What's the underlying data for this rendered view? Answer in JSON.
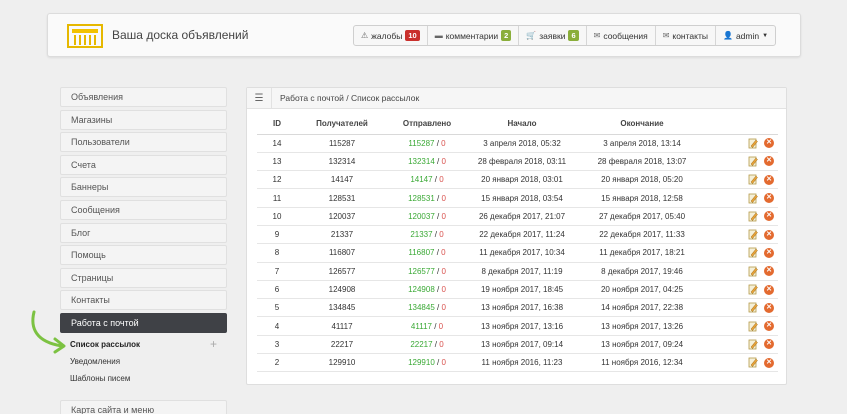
{
  "header": {
    "site_title": "Ваша доска объявлений",
    "nav": [
      {
        "icon": "warning-icon",
        "label": "жалобы",
        "badge": "10",
        "badge_color": "#c9302c"
      },
      {
        "icon": "comment-icon",
        "label": "комментарии",
        "badge": "2",
        "badge_color": "#8aae3a"
      },
      {
        "icon": "cart-icon",
        "label": "заявки",
        "badge": "6",
        "badge_color": "#8aae3a"
      },
      {
        "icon": "envelope-icon",
        "label": "сообщения",
        "badge": "",
        "badge_color": ""
      },
      {
        "icon": "envelope-icon",
        "label": "контакты",
        "badge": "",
        "badge_color": ""
      },
      {
        "icon": "user-icon",
        "label": "admin",
        "badge": "",
        "badge_color": ""
      }
    ]
  },
  "sidebar": {
    "items": [
      "Объявления",
      "Магазины",
      "Пользователи",
      "Счета",
      "Баннеры",
      "Сообщения",
      "Блог",
      "Помощь",
      "Страницы",
      "Контакты"
    ],
    "active": "Работа с почтой",
    "sub": [
      "Список рассылок",
      "Уведомления",
      "Шаблоны писем"
    ],
    "bottom": "Карта сайта и меню"
  },
  "panel": {
    "breadcrumb": "Работа с почтой / Список рассылок",
    "columns": [
      "ID",
      "Получателей",
      "Отправлено",
      "Начало",
      "Окончание"
    ],
    "rows": [
      {
        "id": "14",
        "recipients": "115287",
        "sent": "115287",
        "failed": "0",
        "start": "3 апреля 2018, 05:32",
        "end": "3 апреля 2018, 13:14"
      },
      {
        "id": "13",
        "recipients": "132314",
        "sent": "132314",
        "failed": "0",
        "start": "28 февраля 2018, 03:11",
        "end": "28 февраля 2018, 13:07"
      },
      {
        "id": "12",
        "recipients": "14147",
        "sent": "14147",
        "failed": "0",
        "start": "20 января 2018, 03:01",
        "end": "20 января 2018, 05:20"
      },
      {
        "id": "11",
        "recipients": "128531",
        "sent": "128531",
        "failed": "0",
        "start": "15 января 2018, 03:54",
        "end": "15 января 2018, 12:58"
      },
      {
        "id": "10",
        "recipients": "120037",
        "sent": "120037",
        "failed": "0",
        "start": "26 декабря 2017, 21:07",
        "end": "27 декабря 2017, 05:40"
      },
      {
        "id": "9",
        "recipients": "21337",
        "sent": "21337",
        "failed": "0",
        "start": "22 декабря 2017, 11:24",
        "end": "22 декабря 2017, 11:33"
      },
      {
        "id": "8",
        "recipients": "116807",
        "sent": "116807",
        "failed": "0",
        "start": "11 декабря 2017, 10:34",
        "end": "11 декабря 2017, 18:21"
      },
      {
        "id": "7",
        "recipients": "126577",
        "sent": "126577",
        "failed": "0",
        "start": "8 декабря 2017, 11:19",
        "end": "8 декабря 2017, 19:46"
      },
      {
        "id": "6",
        "recipients": "124908",
        "sent": "124908",
        "failed": "0",
        "start": "19 ноября 2017, 18:45",
        "end": "20 ноября 2017, 04:25"
      },
      {
        "id": "5",
        "recipients": "134845",
        "sent": "134845",
        "failed": "0",
        "start": "13 ноября 2017, 16:38",
        "end": "14 ноября 2017, 22:38"
      },
      {
        "id": "4",
        "recipients": "41117",
        "sent": "41117",
        "failed": "0",
        "start": "13 ноября 2017, 13:16",
        "end": "13 ноября 2017, 13:26"
      },
      {
        "id": "3",
        "recipients": "22217",
        "sent": "22217",
        "failed": "0",
        "start": "13 ноября 2017, 09:14",
        "end": "13 ноября 2017, 09:24"
      },
      {
        "id": "2",
        "recipients": "129910",
        "sent": "129910",
        "failed": "0",
        "start": "11 ноября 2016, 11:23",
        "end": "11 ноября 2016, 12:34"
      }
    ]
  }
}
